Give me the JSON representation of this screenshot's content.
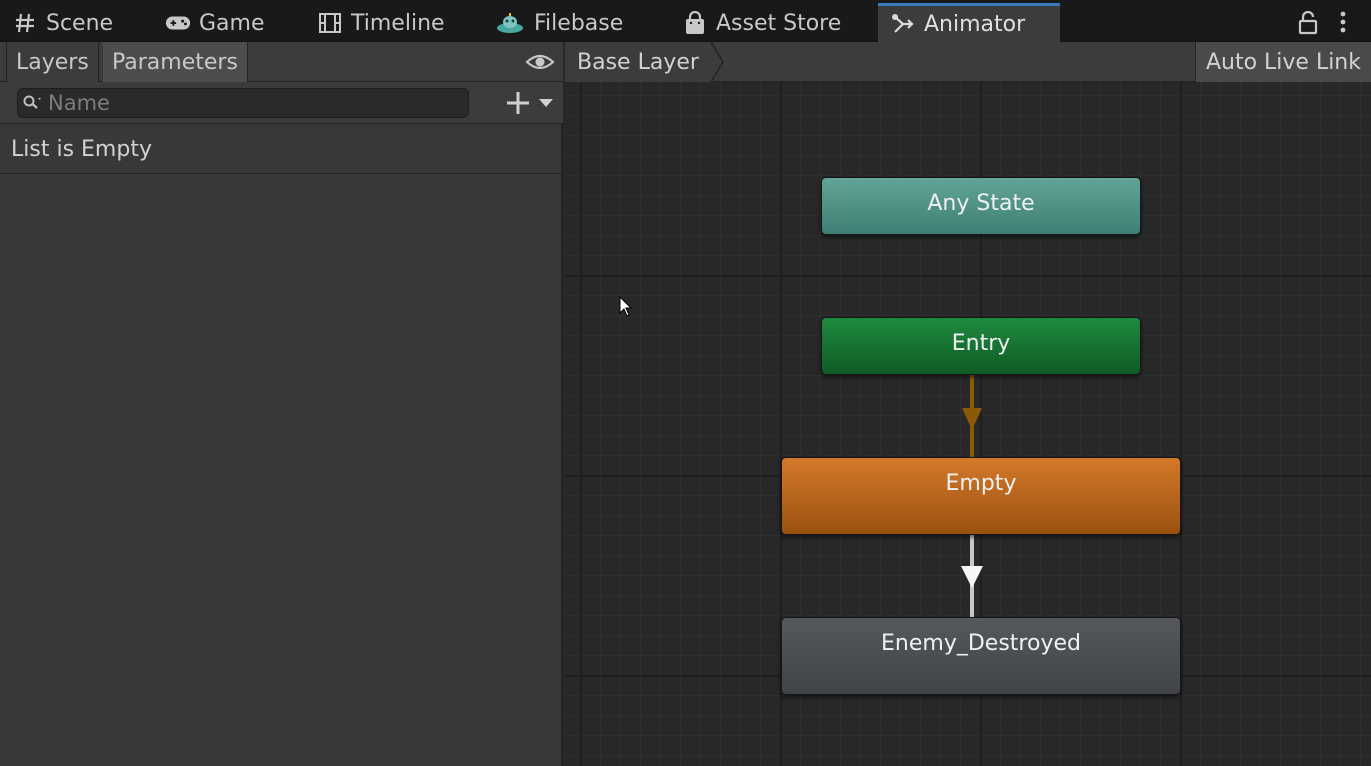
{
  "tabs": [
    {
      "label": "Scene",
      "icon": "grid-hash-icon"
    },
    {
      "label": "Game",
      "icon": "gamepad-icon"
    },
    {
      "label": "Timeline",
      "icon": "film-strip-icon"
    },
    {
      "label": "Filebase",
      "icon": "filebase-logo-icon"
    },
    {
      "label": "Asset Store",
      "icon": "shopping-bag-icon"
    },
    {
      "label": "Animator",
      "icon": "animator-branch-icon",
      "active": true
    }
  ],
  "left_panel": {
    "tabs": [
      "Layers",
      "Parameters"
    ],
    "active_tab": "Parameters",
    "search_placeholder": "Name",
    "empty_message": "List is Empty"
  },
  "graph": {
    "breadcrumb": "Base Layer",
    "auto_live_link": "Auto Live Link",
    "states": [
      {
        "name": "Any State",
        "kind": "any",
        "color": "#5a9d91"
      },
      {
        "name": "Entry",
        "kind": "entry",
        "color": "#167a33"
      },
      {
        "name": "Empty",
        "kind": "default",
        "color": "#c36c1e"
      },
      {
        "name": "Enemy_Destroyed",
        "kind": "normal",
        "color": "#4a4d51"
      }
    ],
    "transitions": [
      {
        "from": "Entry",
        "to": "Empty",
        "color": "#8a5a05"
      },
      {
        "from": "Empty",
        "to": "Enemy_Destroyed",
        "color": "#e6e6e6"
      }
    ]
  },
  "colors": {
    "accent": "#3a79bb",
    "panel": "#383838",
    "graph_bg": "#282828"
  }
}
